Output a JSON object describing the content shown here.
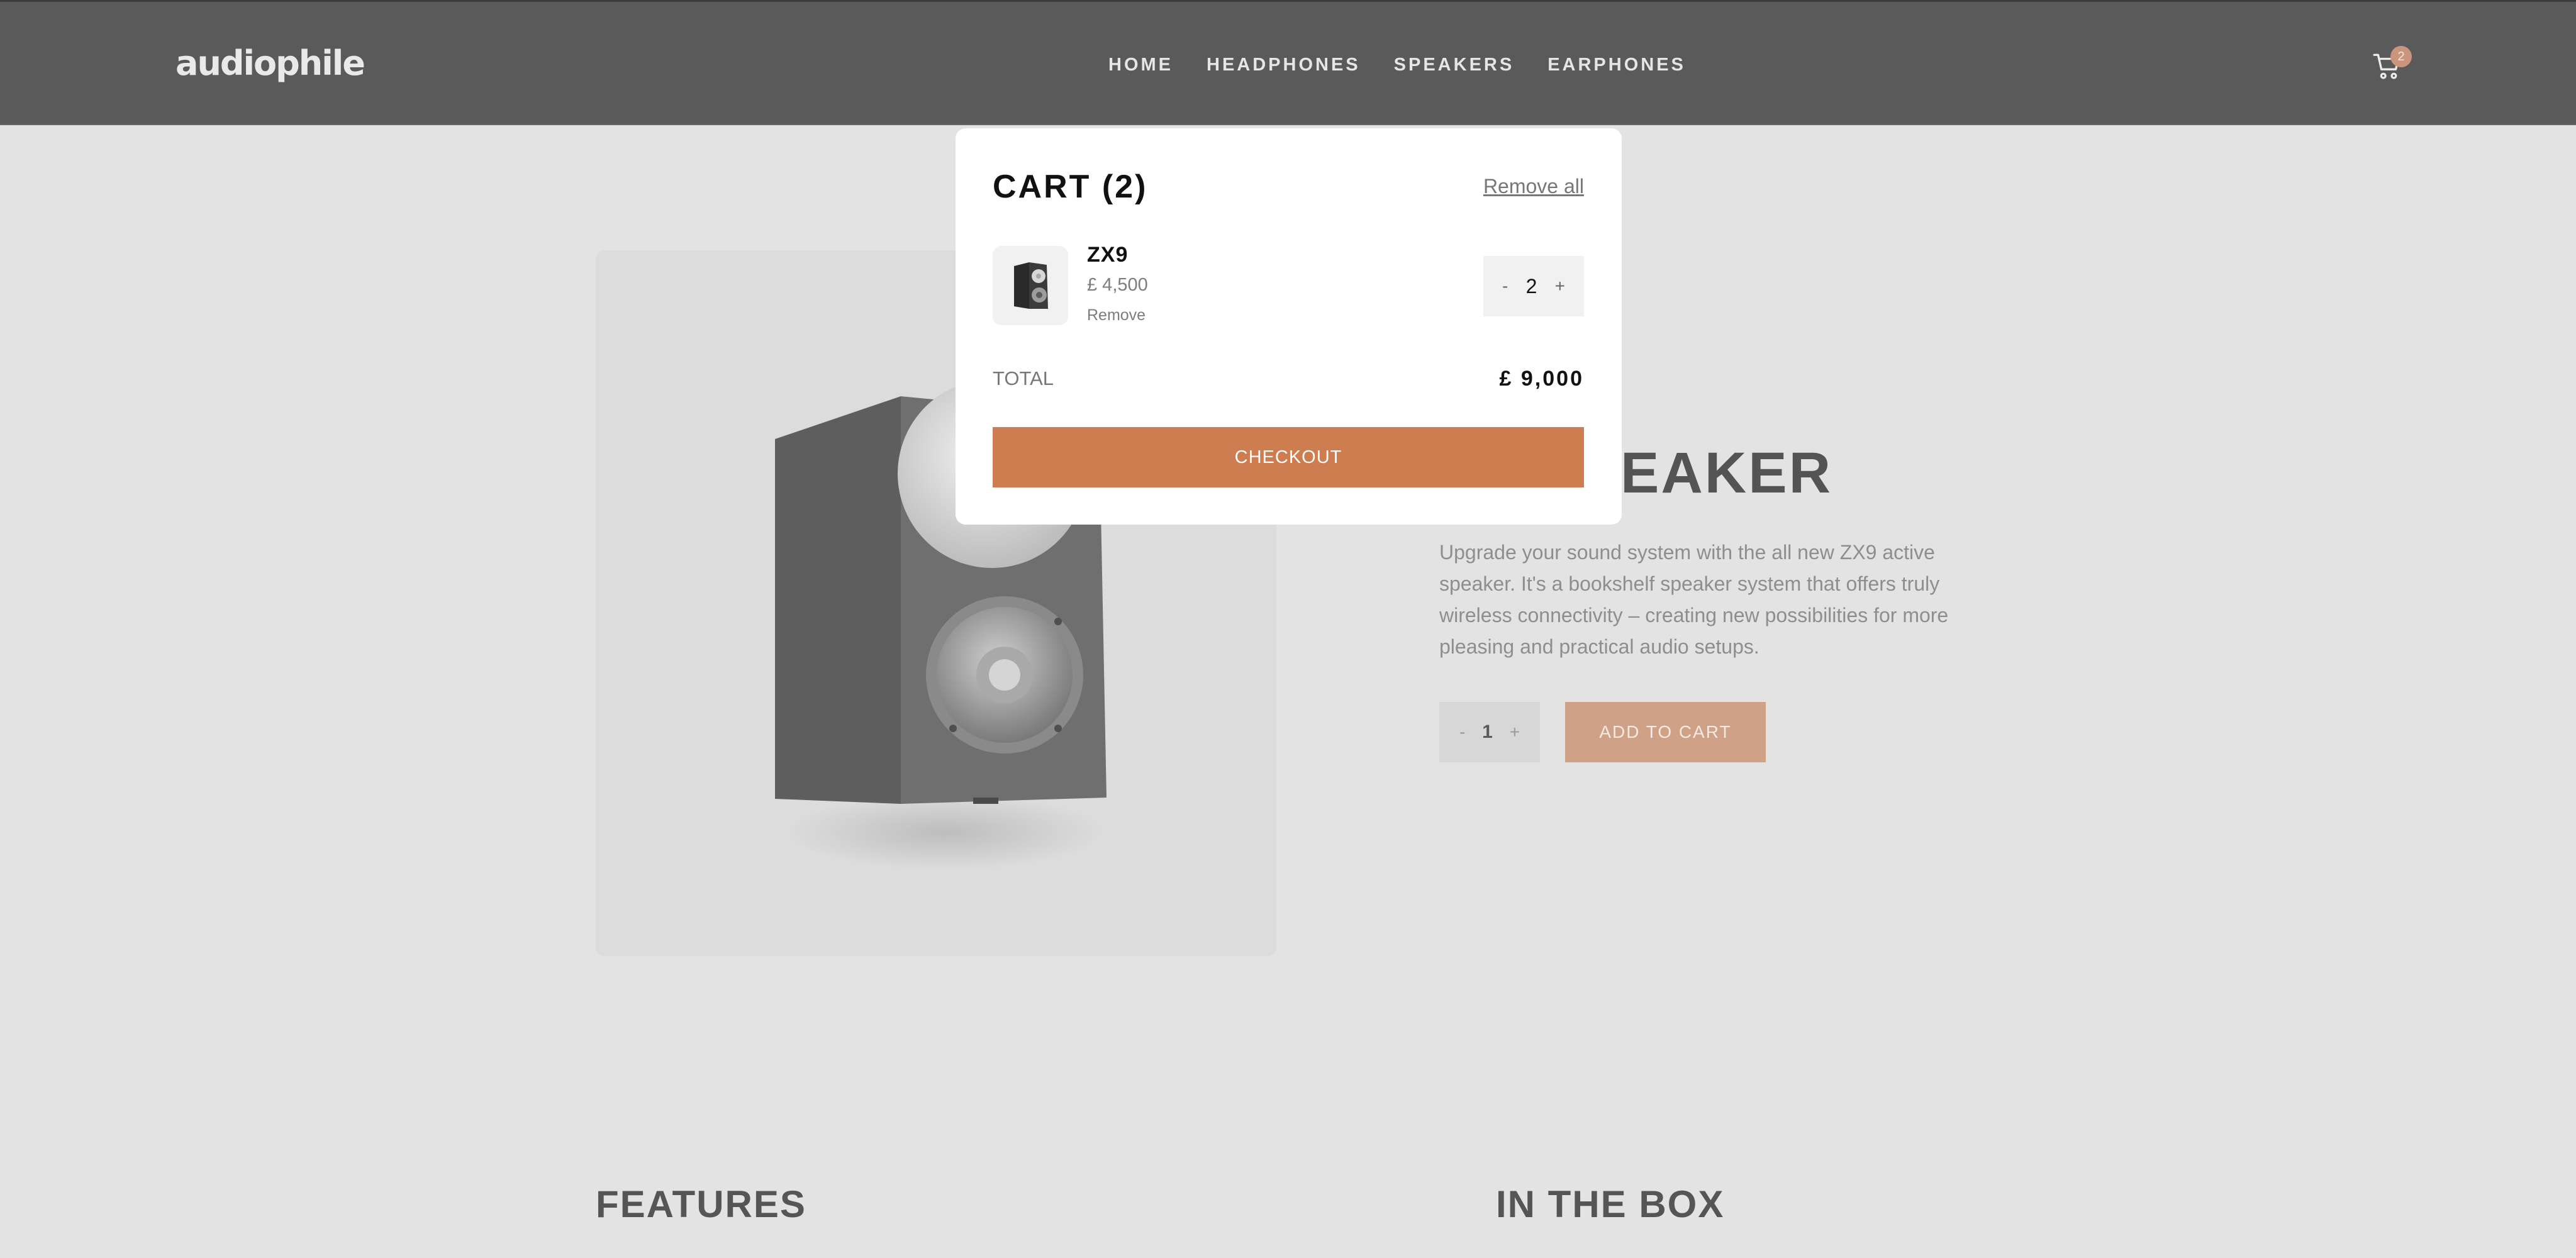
{
  "header": {
    "logo": "audiophile",
    "nav": [
      "HOME",
      "HEADPHONES",
      "SPEAKERS",
      "EARPHONES"
    ],
    "cart_icon": "cart-icon",
    "cart_count": "2"
  },
  "product": {
    "title_fragment": "EAKER",
    "description": "Upgrade your sound system with the all new ZX9 active speaker. It's a bookshelf speaker system that offers truly wireless connectivity – creating new possibilities for more pleasing and practical audio setups.",
    "quantity": "1",
    "minus": "-",
    "plus": "+",
    "add_to_cart": "ADD TO CART"
  },
  "sections": {
    "features": "FEATURES",
    "in_the_box": "IN THE BOX"
  },
  "cart": {
    "title": "CART (2)",
    "remove_all": "Remove all",
    "items": [
      {
        "name": "ZX9",
        "price": "£ 4,500",
        "remove": "Remove",
        "quantity": "2"
      }
    ],
    "minus": "-",
    "plus": "+",
    "total_label": "TOTAL",
    "total_value": "£ 9,000",
    "checkout": "CHECKOUT"
  },
  "colors": {
    "accent": "#D87D4A",
    "header_bg": "#5a5a5a",
    "overlay_bg": "#e3e3e3"
  }
}
